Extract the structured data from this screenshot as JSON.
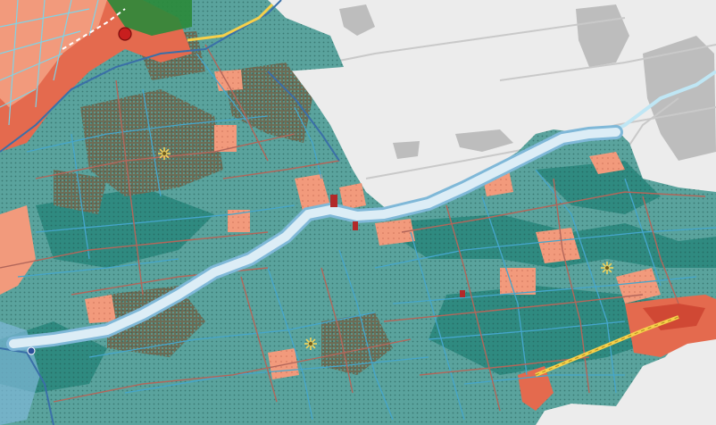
{
  "map": {
    "colors": {
      "outside": "#ececec",
      "outside_urban": "#bdbdbd",
      "land": "#5aa39d",
      "land_dark": "#2f8a80",
      "dense_pattern": "#6b6a52",
      "river": "#cfe6f2",
      "river_edge": "#7fb8d8",
      "ditch": "#45a6cc",
      "road": "#b2665a",
      "urban": "#e46a4e",
      "urban_light": "#f29a7c",
      "dyke": "#3a6fa8",
      "rail": "#f6d04a",
      "green": "#2a8a3a",
      "marker_red": "#c81e1e"
    },
    "symbols": [
      "sun-symbol",
      "sun-symbol",
      "sun-symbol",
      "red-marker",
      "blue-marker"
    ]
  }
}
